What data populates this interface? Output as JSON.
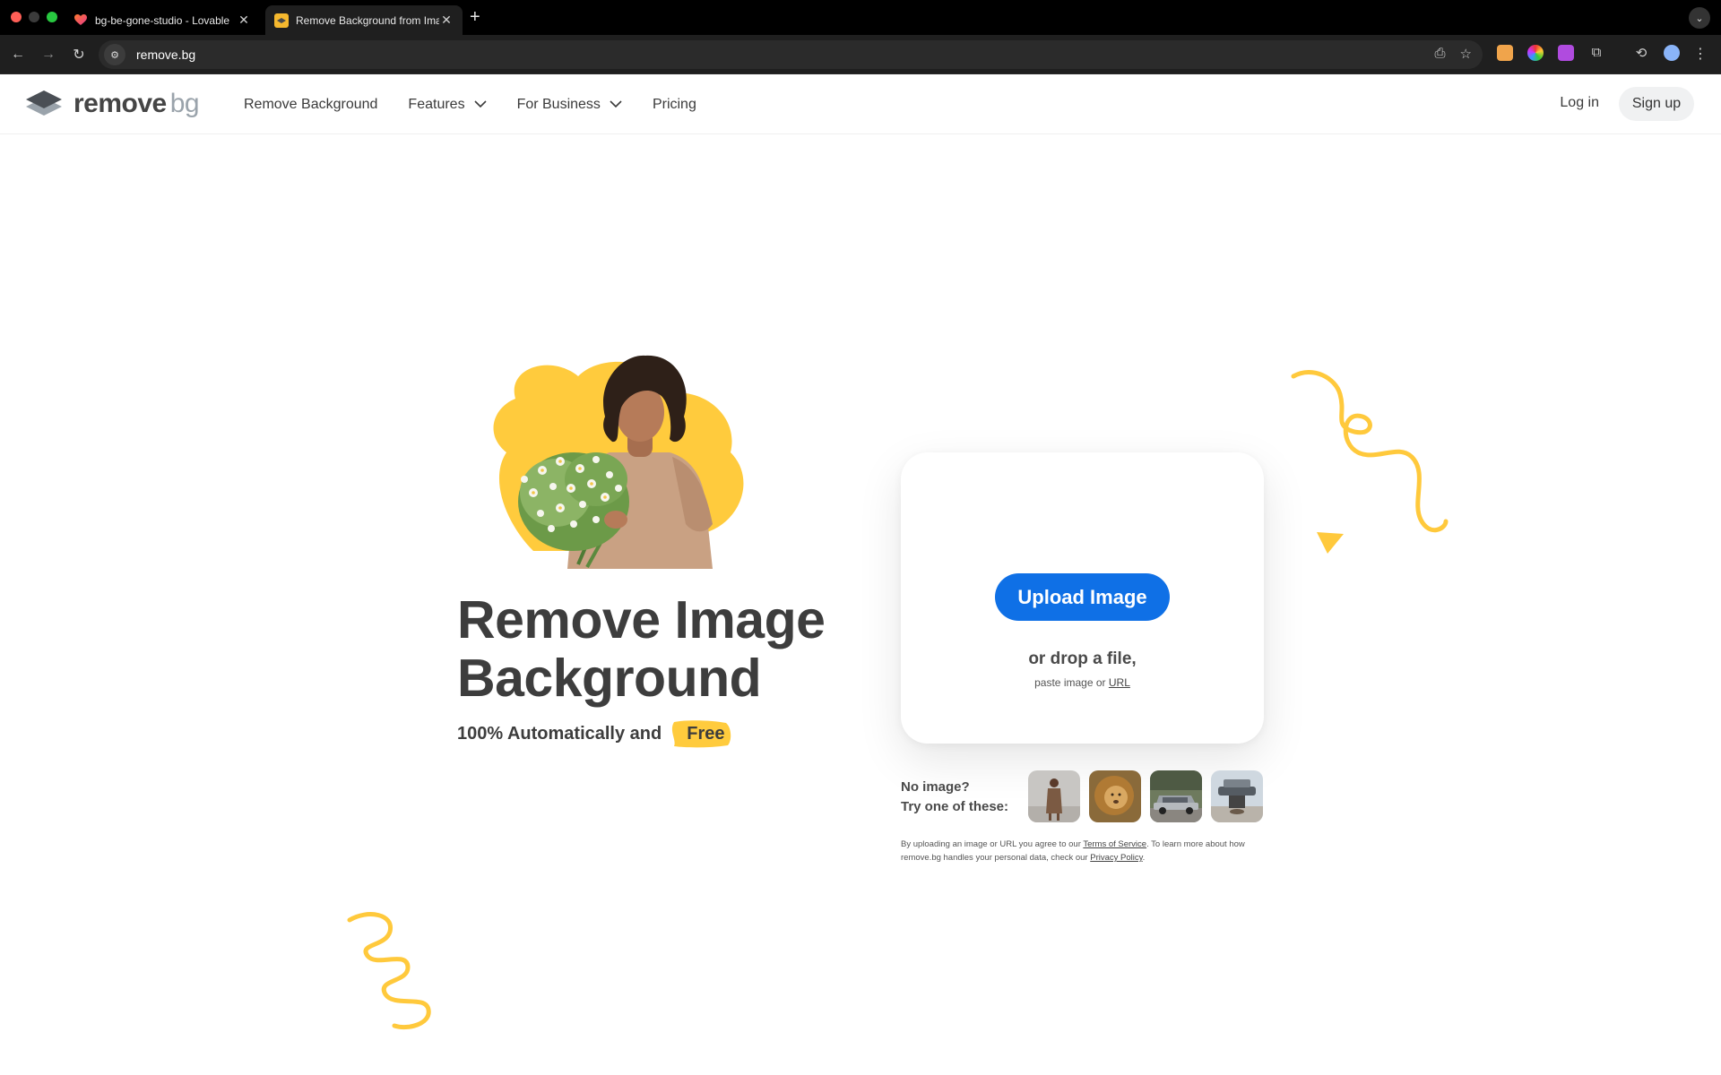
{
  "browser": {
    "tabs": [
      {
        "title": "bg-be-gone-studio - Lovable",
        "active": false
      },
      {
        "title": "Remove Background from Ima",
        "active": true
      }
    ],
    "url": "remove.bg"
  },
  "header": {
    "logo_main": "remove",
    "logo_accent": "bg",
    "nav": [
      {
        "label": "Remove Background",
        "has_dropdown": false
      },
      {
        "label": "Features",
        "has_dropdown": true
      },
      {
        "label": "For Business",
        "has_dropdown": true
      },
      {
        "label": "Pricing",
        "has_dropdown": false
      }
    ],
    "login_label": "Log in",
    "signup_label": "Sign up"
  },
  "hero": {
    "title_line1": "Remove Image",
    "title_line2": "Background",
    "subtitle": "100% Automatically and",
    "highlight": "Free"
  },
  "upload": {
    "button_label": "Upload Image",
    "drop_text": "or drop a file,",
    "paste_text": "paste image or",
    "url_link": "URL"
  },
  "samples": {
    "label_line1": "No image?",
    "label_line2": "Try one of these:",
    "items": [
      "woman",
      "lion",
      "car",
      "coffee-machine"
    ]
  },
  "legal": {
    "part1": "By uploading an image or URL you agree to our",
    "tos_link": "Terms of Service",
    "part2": ". To learn more about how remove.bg handles your personal data, check our",
    "privacy_link": "Privacy Policy",
    "part3": "."
  },
  "colors": {
    "accent_blue": "#0f70e6",
    "accent_yellow": "#ffcb3d",
    "text_dark": "#3d3d3d"
  }
}
